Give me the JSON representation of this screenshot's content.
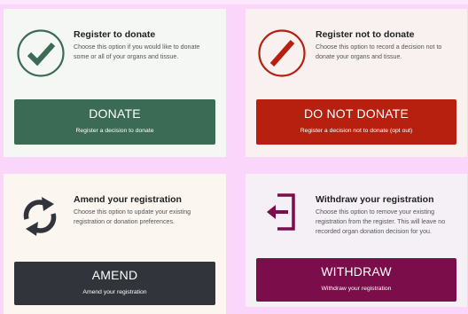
{
  "cards": {
    "donate": {
      "title": "Register to donate",
      "desc_line1": "Choose this option if you would like to donate",
      "desc_line2": "some or all of your organs and tissue.",
      "button_label": "DONATE",
      "button_sub": "Register a decision to donate",
      "icon": "check-circle-icon",
      "color": "#3c6b55"
    },
    "no_donate": {
      "title": "Register not to donate",
      "desc_line1": "Choose this option to record a decision not to",
      "desc_line2": "donate your organs and tissue.",
      "button_label": "DO NOT DONATE",
      "button_sub": "Register a decision not to donate (opt out)",
      "icon": "slash-circle-icon",
      "color": "#b71f0f"
    },
    "amend": {
      "title": "Amend your registration",
      "desc_line1": "Choose this option to update your existing",
      "desc_line2": "registration or donation preferences.",
      "button_label": "AMEND",
      "button_sub": "Amend your registration",
      "icon": "refresh-arrows-icon",
      "color": "#31343a"
    },
    "withdraw": {
      "title": "Withdraw your registration",
      "desc_line1": "Choose this option to remove your existing",
      "desc_line2": "registration from the register. This will leave no",
      "desc_line3": "recorded organ donation decision for you.",
      "button_label": "WITHDRAW",
      "button_sub": "Withdraw your registration",
      "icon": "exit-door-icon",
      "color": "#7b0d4a"
    }
  }
}
